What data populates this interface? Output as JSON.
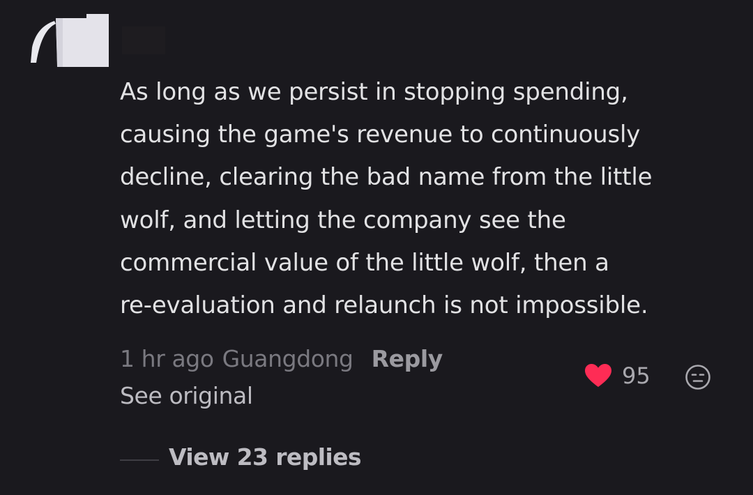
{
  "comment": {
    "text": "As long as we persist in stopping spending,\ncausing the game's revenue to continuously\ndecline, clearing the bad name from the little\nwolf, and letting the company see the\ncommercial value of the little wolf, then a\nre-evaluation and relaunch is not impossible.",
    "time": "1 hr ago",
    "location": "Guangdong",
    "reply_label": "Reply",
    "see_original_label": "See original",
    "likes": "95",
    "view_replies_label": "View 23 replies"
  },
  "icons": {
    "like": "heart-icon",
    "dislike": "expressionless-face-icon",
    "avatar": "avatar-image"
  },
  "colors": {
    "background": "#1a191e",
    "heart": "#fe2c55",
    "text_primary": "#e2e2e4",
    "text_secondary": "#7a7980"
  }
}
